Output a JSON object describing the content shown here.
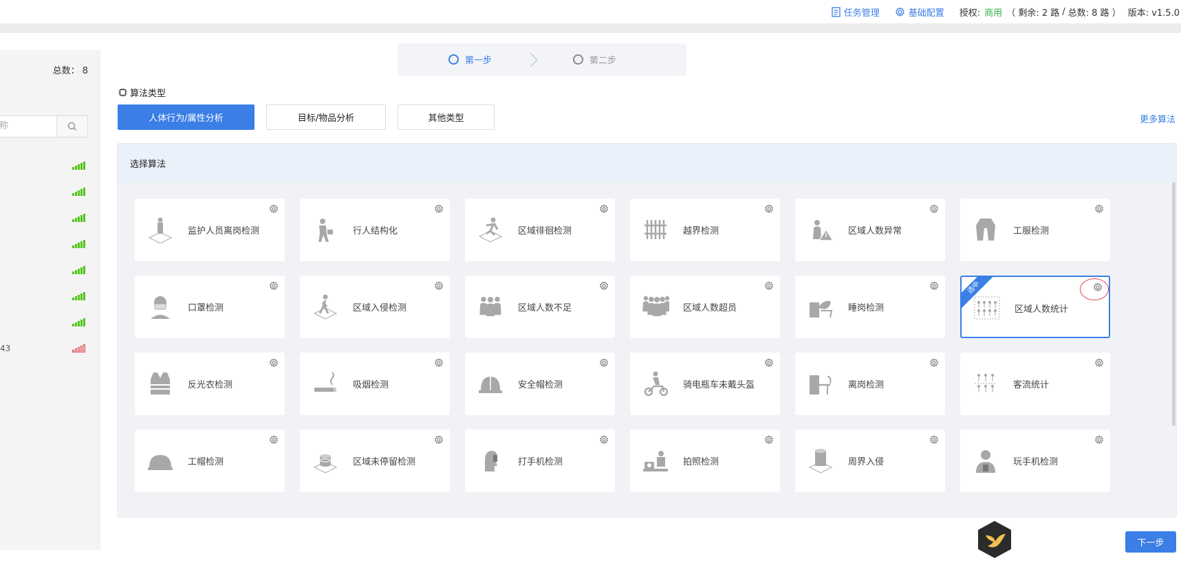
{
  "topbar": {
    "task_mgmt": "任务管理",
    "base_config": "基础配置",
    "license_label": "授权:",
    "license_type": "商用",
    "remaining": "（ 剩余: 2 路",
    "slash": "/",
    "total": "总数: 8 路 ）",
    "version": "版本: v1.5.0"
  },
  "sidebar": {
    "total_label": "总数： 8",
    "search_placeholder": "称",
    "devices": [
      {
        "num": "",
        "signal": "good"
      },
      {
        "num": "",
        "signal": "good"
      },
      {
        "num": "",
        "signal": "good"
      },
      {
        "num": "",
        "signal": "good"
      },
      {
        "num": "",
        "signal": "good"
      },
      {
        "num": "",
        "signal": "good"
      },
      {
        "num": "",
        "signal": "good"
      },
      {
        "num": "43",
        "signal": "bad"
      }
    ]
  },
  "steps": {
    "step1": "第一步",
    "step2": "第二步"
  },
  "algo_type_label": "算法类型",
  "tabs": [
    {
      "label": "人体行为/属性分析",
      "active": true
    },
    {
      "label": "目标/物品分析",
      "active": false
    },
    {
      "label": "其他类型",
      "active": false
    }
  ],
  "more_algos": "更多算法",
  "panel_title": "选择算法",
  "selected_badge": "选中",
  "cards": [
    {
      "name": "监护人员离岗检测",
      "icon": "guard-person-icon"
    },
    {
      "name": "行人结构化",
      "icon": "pedestrian-icon"
    },
    {
      "name": "区域徘徊检测",
      "icon": "loitering-icon"
    },
    {
      "name": "越界检测",
      "icon": "fence-icon"
    },
    {
      "name": "区域人数异常",
      "icon": "person-warning-icon"
    },
    {
      "name": "工服检测",
      "icon": "workwear-icon"
    },
    {
      "name": "口罩检测",
      "icon": "mask-icon"
    },
    {
      "name": "区域入侵检测",
      "icon": "intrusion-icon"
    },
    {
      "name": "区域人数不足",
      "icon": "group-icon"
    },
    {
      "name": "区域人数超员",
      "icon": "crowd-icon"
    },
    {
      "name": "睡岗检测",
      "icon": "sleeping-icon"
    },
    {
      "name": "区域人数统计",
      "icon": "people-count-icon",
      "selected": true
    },
    {
      "name": "反光衣检测",
      "icon": "vest-icon"
    },
    {
      "name": "吸烟检测",
      "icon": "smoking-icon"
    },
    {
      "name": "安全帽检测",
      "icon": "helmet-icon"
    },
    {
      "name": "骑电瓶车未戴头盔",
      "icon": "scooter-icon"
    },
    {
      "name": "离岗检测",
      "icon": "empty-desk-icon"
    },
    {
      "name": "客流统计",
      "icon": "flow-count-icon"
    },
    {
      "name": "工帽检测",
      "icon": "work-cap-icon"
    },
    {
      "name": "区域未停留检测",
      "icon": "stay-icon"
    },
    {
      "name": "打手机检测",
      "icon": "phone-call-icon"
    },
    {
      "name": "拍照检测",
      "icon": "photo-icon"
    },
    {
      "name": "周界入侵",
      "icon": "perimeter-icon"
    },
    {
      "name": "玩手机检测",
      "icon": "phone-play-icon"
    }
  ],
  "next_button": "下一步",
  "colors": {
    "accent": "#3a7ee6",
    "ok": "#33b14a",
    "bad": "#e0434b",
    "signal_good": "#52c41a"
  }
}
